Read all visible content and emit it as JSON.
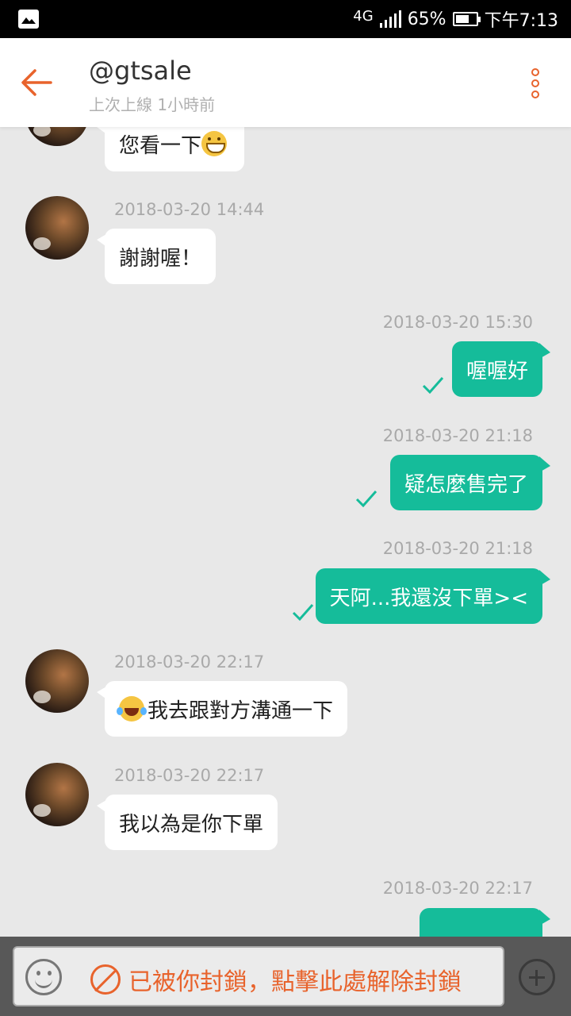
{
  "status_bar": {
    "network": "4G",
    "battery_percent": "65%",
    "battery_level": 0.65,
    "time": "下午7:13"
  },
  "header": {
    "title": "@gtsale",
    "subtitle": "上次上線 1小時前",
    "back_icon": "arrow-left-icon",
    "menu_icon": "more-vertical-icon",
    "accent_color": "#e8632c"
  },
  "messages": [
    {
      "direction": "in",
      "timestamp": "",
      "text": "您看一下",
      "emoji": "grin"
    },
    {
      "direction": "in",
      "timestamp": "2018-03-20 14:44",
      "text": "謝謝喔！"
    },
    {
      "direction": "out",
      "timestamp": "2018-03-20 15:30",
      "text": "喔喔好"
    },
    {
      "direction": "out",
      "timestamp": "2018-03-20 21:18",
      "text": "疑怎麼售完了"
    },
    {
      "direction": "out",
      "timestamp": "2018-03-20 21:18",
      "text": "天阿...我還沒下單><"
    },
    {
      "direction": "in",
      "timestamp": "2018-03-20 22:17",
      "text": "我去跟對方溝通一下",
      "emoji": "laugh"
    },
    {
      "direction": "in",
      "timestamp": "2018-03-20 22:17",
      "text": "我以為是你下單"
    },
    {
      "direction": "out",
      "timestamp": "2018-03-20 22:17",
      "text": ""
    }
  ],
  "colors": {
    "outgoing_bubble": "#15bc9a",
    "incoming_bubble": "#ffffff",
    "chat_background": "#e8e8e8"
  },
  "bottom_bar": {
    "blocked_text": "已被你封鎖，點擊此處解除封鎖",
    "emoji_icon": "smiley-icon",
    "block_icon": "no-entry-icon",
    "add_icon": "plus-circle-icon"
  }
}
